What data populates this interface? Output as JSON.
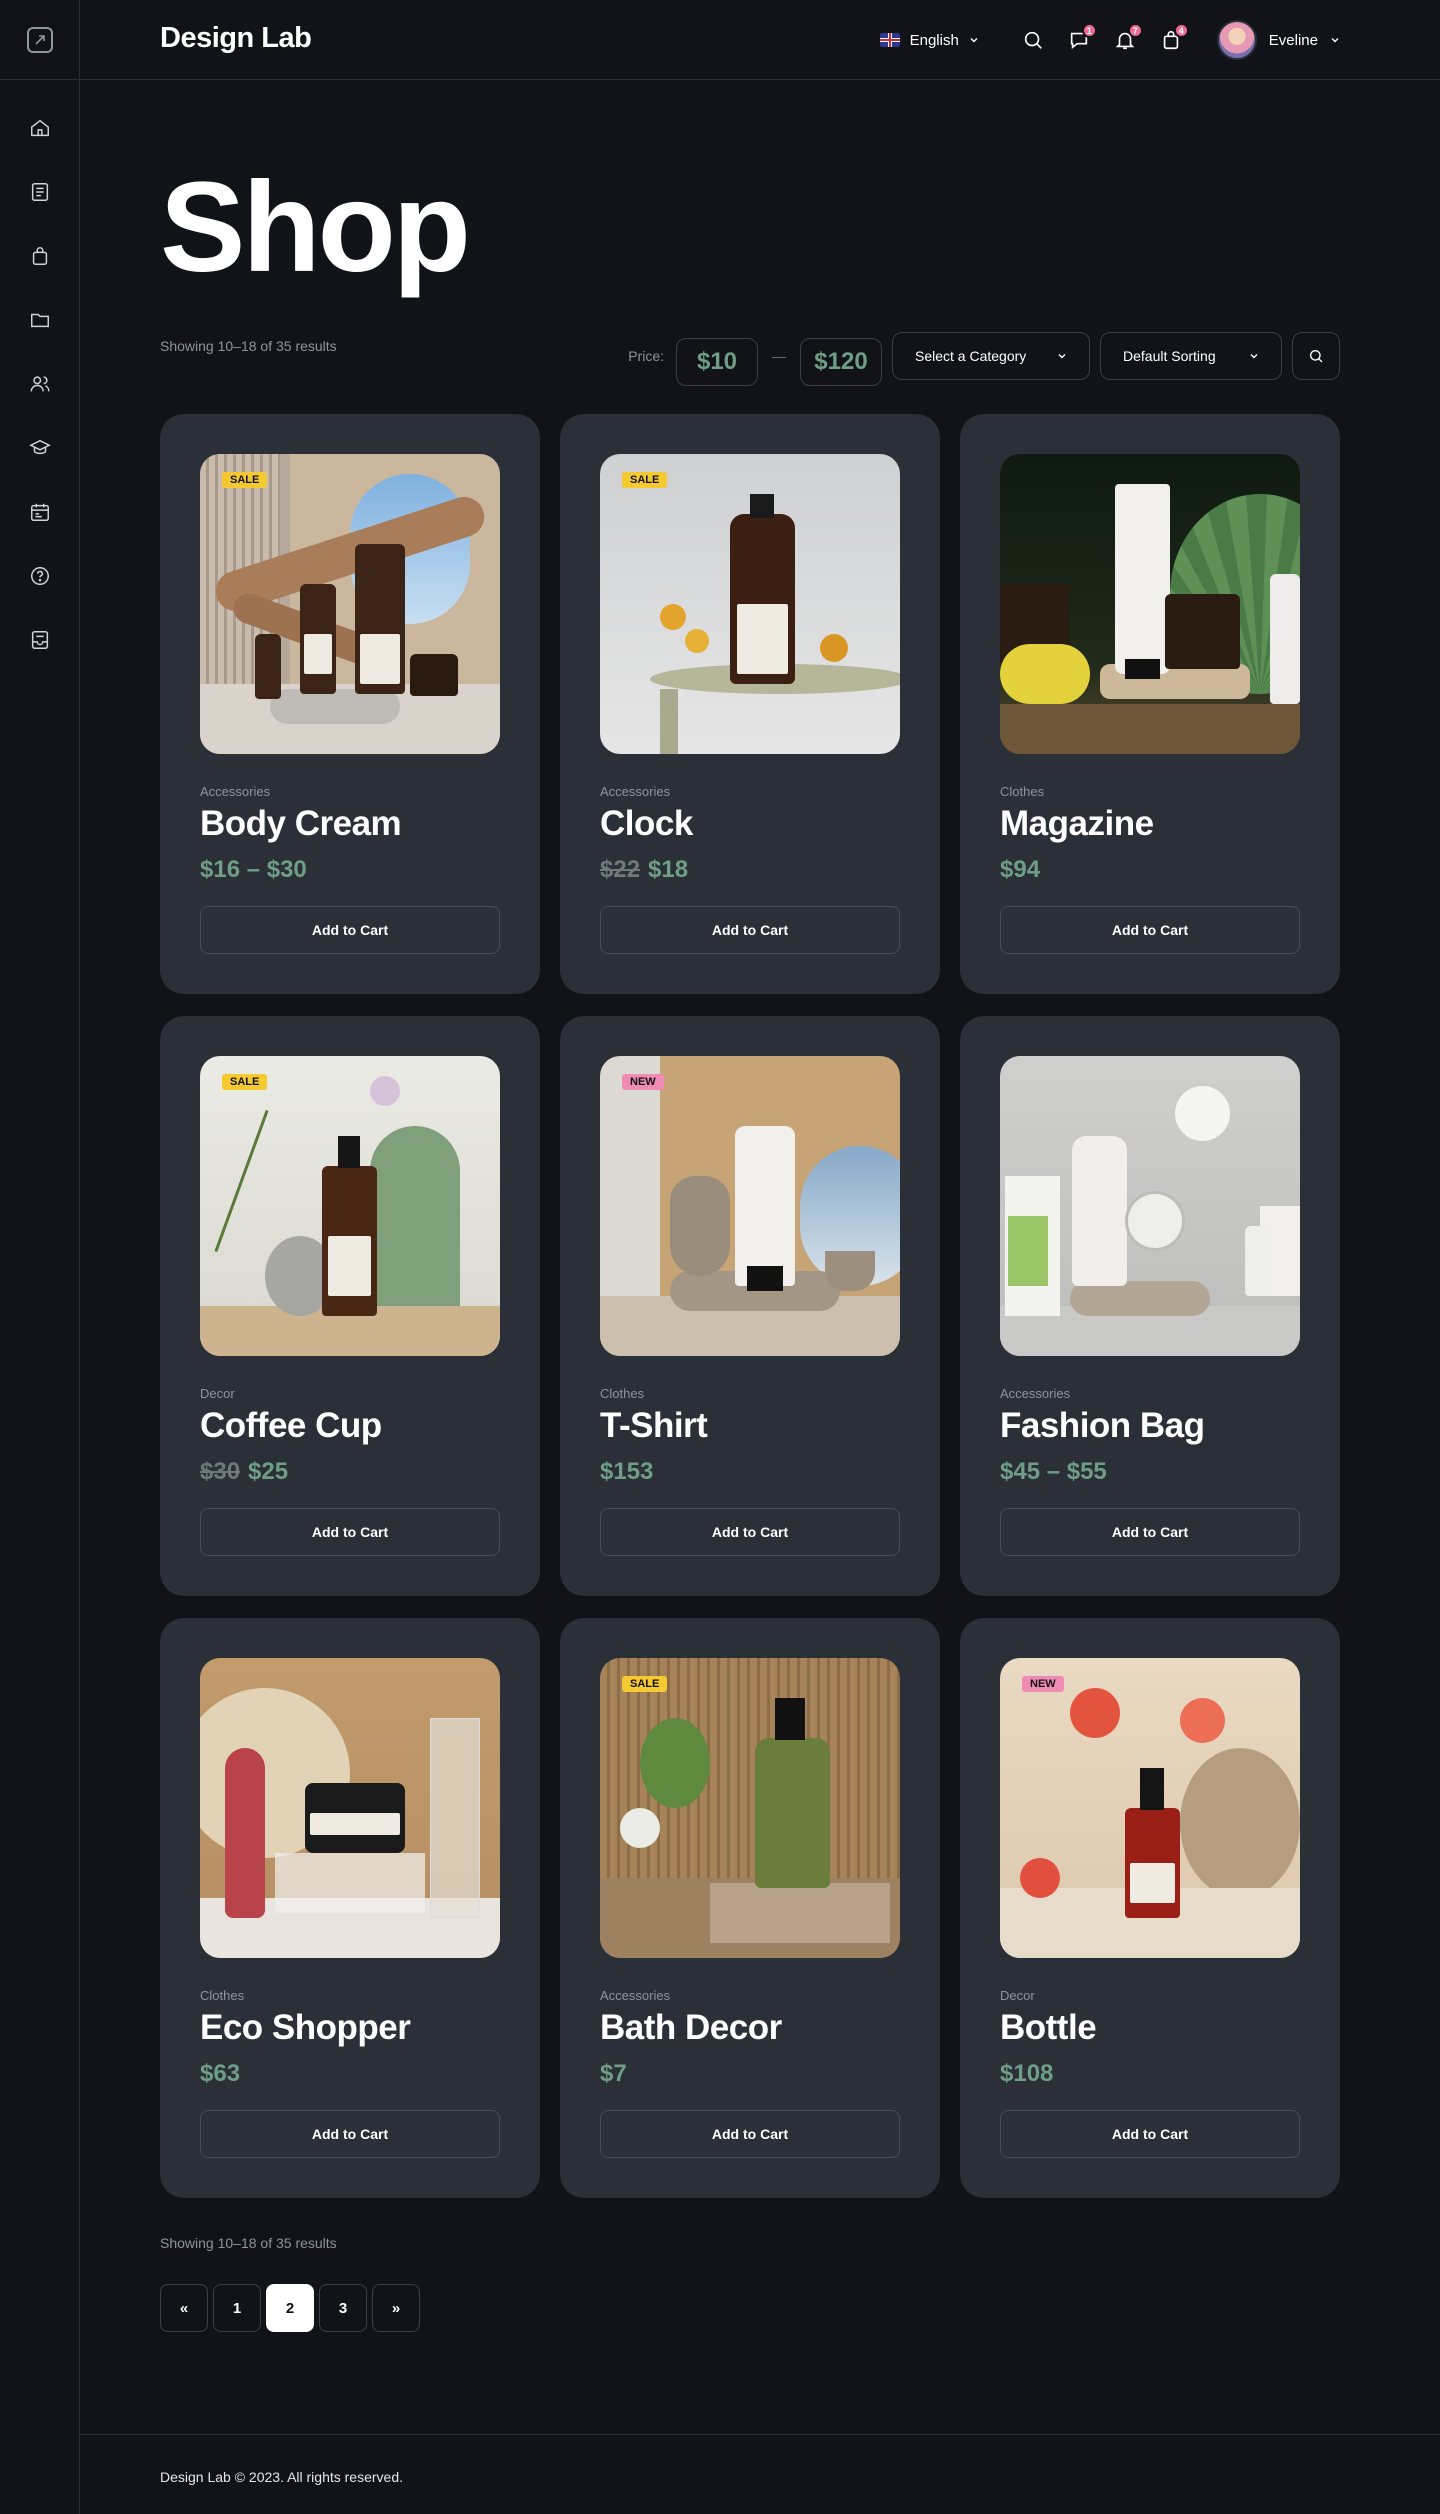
{
  "app": {
    "brand": "Design Lab"
  },
  "header": {
    "language": "English",
    "badges": {
      "messages": "1",
      "notifications": "7",
      "cart": "4"
    },
    "user": "Eveline"
  },
  "page": {
    "title": "Shop",
    "showing_top": "Showing 10–18 of 35 results",
    "showing_bottom": "Showing 10–18 of 35 results"
  },
  "filters": {
    "price_label": "Price:",
    "min": "$10",
    "separator": "—",
    "max": "$120",
    "category": "Select a Category",
    "sorting": "Default Sorting"
  },
  "products": [
    {
      "tag": "SALE",
      "category": "Accessories",
      "name": "Body Cream",
      "price": "$16 – $30",
      "old_price": "",
      "button": "Add to Cart"
    },
    {
      "tag": "SALE",
      "category": "Accessories",
      "name": "Clock",
      "price": "$18",
      "old_price": "$22",
      "button": "Add to Cart"
    },
    {
      "tag": "",
      "category": "Clothes",
      "name": "Magazine",
      "price": "$94",
      "old_price": "",
      "button": "Add to Cart"
    },
    {
      "tag": "SALE",
      "category": "Decor",
      "name": "Coffee Cup",
      "price": "$25",
      "old_price": "$30",
      "button": "Add to Cart"
    },
    {
      "tag": "NEW",
      "category": "Clothes",
      "name": "T-Shirt",
      "price": "$153",
      "old_price": "",
      "button": "Add to Cart"
    },
    {
      "tag": "",
      "category": "Accessories",
      "name": "Fashion Bag",
      "price": "$45 – $55",
      "old_price": "",
      "button": "Add to Cart"
    },
    {
      "tag": "",
      "category": "Clothes",
      "name": "Eco Shopper",
      "price": "$63",
      "old_price": "",
      "button": "Add to Cart"
    },
    {
      "tag": "SALE",
      "category": "Accessories",
      "name": "Bath Decor",
      "price": "$7",
      "old_price": "",
      "button": "Add to Cart"
    },
    {
      "tag": "NEW",
      "category": "Decor",
      "name": "Bottle",
      "price": "$108",
      "old_price": "",
      "button": "Add to Cart"
    }
  ],
  "pagination": {
    "prev": "«",
    "pages": [
      "1",
      "2",
      "3"
    ],
    "next": "»",
    "current": "2"
  },
  "footer": {
    "text": "Design Lab © 2023. All rights reserved."
  },
  "colors": {
    "background": "#111319",
    "card": "#2a2f38",
    "price_green": "#6e9e86",
    "sale_tag": "#f5c930",
    "new_tag": "#ef8bb5"
  }
}
